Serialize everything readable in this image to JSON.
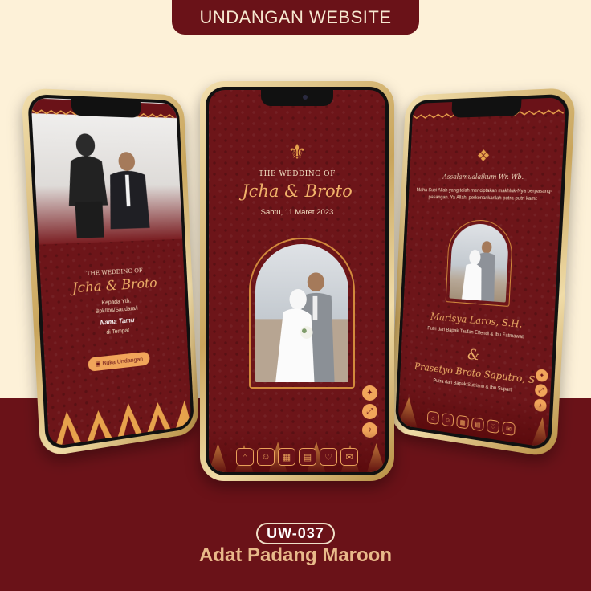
{
  "header": {
    "title": "UNDANGAN WEBSITE"
  },
  "footer": {
    "code": "UW-037",
    "name": "Adat Padang Maroon"
  },
  "colors": {
    "maroon": "#6a1218",
    "cream": "#fdf1d8",
    "accent": "#f1a55a",
    "gold": "#c9a55c"
  },
  "left_phone": {
    "the_wedding_of": "THE WEDDING OF",
    "names": "Jcha & Broto",
    "kepada": "Kepada Yth.",
    "salutation": "Bpk/Ibu/Saudara/i",
    "guest": "Nama Tamu",
    "place": "di Tempat",
    "open_button": "Buka Undangan"
  },
  "center_phone": {
    "the_wedding_of": "THE WEDDING OF",
    "names": "Jcha & Broto",
    "date": "Sabtu, 11 Maret 2023",
    "side_icons": [
      "gift-icon",
      "expand-icon",
      "music-icon"
    ],
    "nav_icons": [
      "home-icon",
      "couple-icon",
      "calendar-icon",
      "clipboard-icon",
      "heart-icon",
      "chat-icon"
    ]
  },
  "right_phone": {
    "greeting": "Assalamualaikum Wr. Wb.",
    "verse": "Maha Suci Allah yang telah menciptakan makhluk-Nya berpasang-pasangan. Ya Allah, perkenankanlah putra-putri kami:",
    "bride_name": "Marisya Laros, S.H.",
    "bride_parents": "Putri dari Bapak Taufan Effendi & Ibu Fatmawati",
    "ampersand": "&",
    "groom_name": "Prasetyo Broto Saputro, S",
    "groom_parents": "Putra dari Bapak Sutrisno & Ibu Suparti"
  }
}
